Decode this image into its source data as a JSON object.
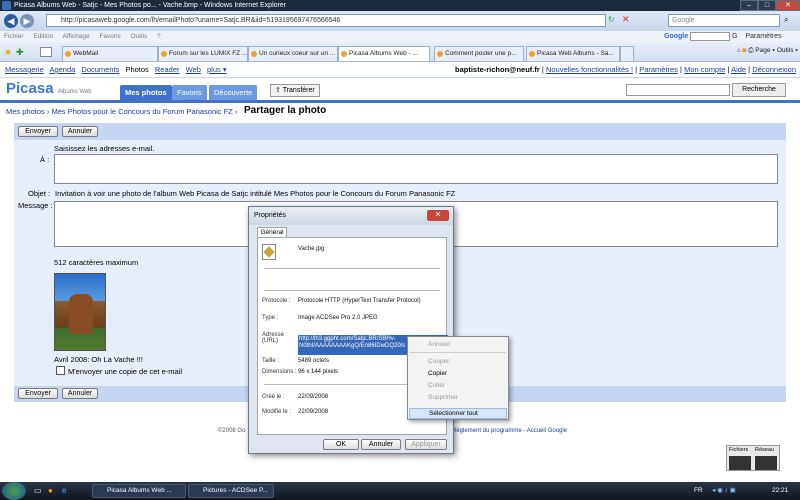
{
  "window": {
    "title": "Picasa Albums Web - Satjc - Mes Photos po... - Vache.bmp - Windows Internet Explorer"
  },
  "addressbar": {
    "url": "http://picasaweb.google.com/lh/emailPhoto?uname=Satjc.BR&iid=5193195697476566546",
    "search_placeholder": "Google"
  },
  "menubar": {
    "items": [
      "Fichier",
      "Edition",
      "Affichage",
      "Favoris",
      "Outils",
      "?"
    ]
  },
  "googlebar": {
    "label": "Google",
    "go": "G"
  },
  "ie_tools": {
    "params": "Paramètres",
    "page": "Page",
    "outils": "Outils"
  },
  "tabs": [
    {
      "label": "WebMail"
    },
    {
      "label": "Forum sur les LUMIX FZ ..."
    },
    {
      "label": "Un curieux coeur sur un ..."
    },
    {
      "label": "Picasa Albums Web - ..."
    },
    {
      "label": "Comment poster une p..."
    },
    {
      "label": "Picasa Web Albums - Sa..."
    }
  ],
  "gbar": {
    "links": [
      "Messagerie",
      "Agenda",
      "Documents",
      "Photos",
      "Reader",
      "Web",
      "plus ▾"
    ]
  },
  "user": {
    "email": "baptiste-richon@neuf.fr",
    "new": "Nouvelles fonctionnalités !",
    "links": [
      "Paramètres",
      "Mon compte",
      "Aide",
      "Déconnexion"
    ]
  },
  "picasa": {
    "logo": "Picasa",
    "logo_sub": "Albums Web",
    "tabs": [
      "Mes photos",
      "Favoris",
      "Découverte"
    ],
    "transfer": "Transférer",
    "search_btn": "Recherche"
  },
  "breadcrumb": {
    "items": [
      "Mes photos",
      "Mes Photos pour le Concours du Forum Panasonic FZ"
    ],
    "sep": "›"
  },
  "page_title": "Partager la photo",
  "form": {
    "send": "Envoyer",
    "cancel": "Annuler",
    "hint": "Saisissez les adresses e-mail.",
    "to_label": "À :",
    "subject_label": "Objet :",
    "subject_value": "Invitation à voir une photo de l'album Web Picasa de Satjc intitulé Mes Photos pour le Concours du Forum Panasonic FZ",
    "message_label": "Message :",
    "max_chars": "512 caractères maximum",
    "caption": "Avril 2008: Oh La Vache !!!",
    "copy_label": "M'envoyer une copie de cet e-mail"
  },
  "footer": {
    "left": "©2008 Go",
    "right": "Règlement du programme - Accueil Google"
  },
  "dialog": {
    "title": "Propriétés",
    "close": "✕",
    "tab": "Général",
    "filename": "Vache.jpg",
    "rows": [
      {
        "k": "Protocole :",
        "v": "Protocole HTTP (HyperText Transfer Protocol)"
      },
      {
        "k": "Type :",
        "v": "Image ACDSee Pro 2.0 JPEG"
      },
      {
        "k": "Adresse (URL)",
        "v": "http://lh3.ggpht.com/Satjc.BR/SBHv-N0thI/AAAAAAAAKgQ/En86IDwDQ20/s"
      },
      {
        "k": "Taille :",
        "v": "5489 octets"
      },
      {
        "k": "Dimensions :",
        "v": "96 x 144 pixels"
      },
      {
        "k": "Créé le :",
        "v": "22/09/2008"
      },
      {
        "k": "Modifié le :",
        "v": "22/09/2008"
      }
    ],
    "ok": "OK",
    "cancel": "Annuler",
    "apply": "Appliquer"
  },
  "context_menu": {
    "items": [
      "Annuler",
      "Couper",
      "Copier",
      "Coller",
      "Supprimer",
      "Sélectionner tout"
    ]
  },
  "mini": {
    "a": "Fichiers",
    "b": "Réseau"
  },
  "taskbar": {
    "tasks": [
      "Picasa Albums Web ...",
      "Pictures - ACDSee P..."
    ],
    "lang": "FR",
    "time": "22:21"
  }
}
